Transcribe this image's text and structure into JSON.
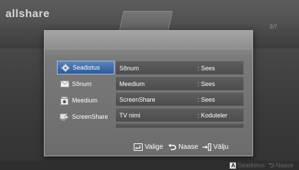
{
  "brand": "allshare",
  "page_indicator": "3/7",
  "left_menu": [
    {
      "label": "Seadistus",
      "icon": "gear-icon",
      "selected": true
    },
    {
      "label": "Sõnum",
      "icon": "envelope-icon",
      "selected": false
    },
    {
      "label": "Meedium",
      "icon": "media-icon",
      "selected": false
    },
    {
      "label": "ScreenShare",
      "icon": "screen-share-icon",
      "selected": false
    }
  ],
  "settings": [
    {
      "name": "Sõnum",
      "value": ": Sees"
    },
    {
      "name": "Meedium",
      "value": ": Sees"
    },
    {
      "name": "ScreenShare",
      "value": ": Sees"
    },
    {
      "name": "TV nimi",
      "value": ": Koduteler"
    }
  ],
  "hints": {
    "select": "Valige",
    "back": "Naase",
    "exit": "Välju"
  },
  "bottom_legend": {
    "key": "A",
    "settings": "Seadistus",
    "back": "Naase"
  },
  "colors": {
    "selection": "#3f6fb0",
    "row_bg": "#555555",
    "text": "#ffffff"
  }
}
